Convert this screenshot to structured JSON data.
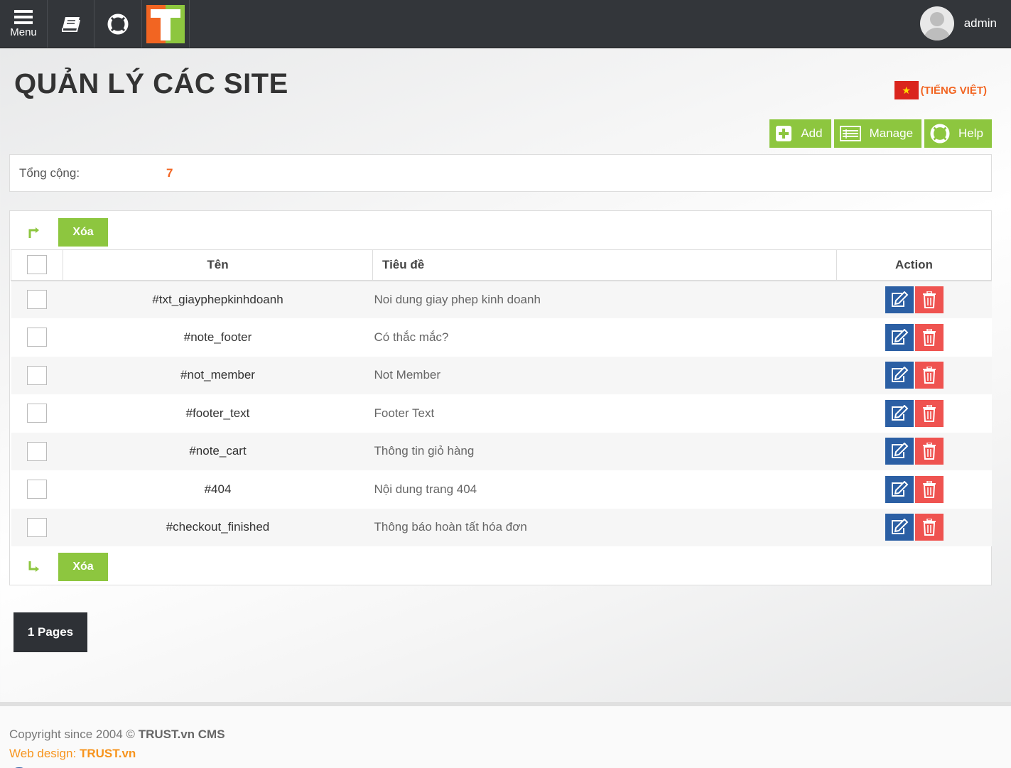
{
  "topbar": {
    "menu_label": "Menu",
    "icons": [
      "menu-icon",
      "book-icon",
      "lifebuoy-icon",
      "logo-icon"
    ],
    "username": "admin"
  },
  "header": {
    "title": "QUẢN LÝ CÁC SITE",
    "language": "(TIẾNG VIỆT)"
  },
  "actions": {
    "add": "Add",
    "manage": "Manage",
    "help": "Help"
  },
  "summary": {
    "total_label": "Tổng cộng:",
    "total_value": "7"
  },
  "bulk": {
    "delete_label": "Xóa"
  },
  "table": {
    "columns": {
      "name": "Tên",
      "title": "Tiêu đề",
      "action": "Action"
    },
    "rows": [
      {
        "name": "#txt_giayphepkinhdoanh",
        "title": "Noi dung giay phep kinh doanh"
      },
      {
        "name": "#note_footer",
        "title": "Có thắc mắc?"
      },
      {
        "name": "#not_member",
        "title": "Not Member"
      },
      {
        "name": "#footer_text",
        "title": "Footer Text"
      },
      {
        "name": "#note_cart",
        "title": "Thông tin giỏ hàng"
      },
      {
        "name": "#404",
        "title": "Nội dung trang 404"
      },
      {
        "name": "#checkout_finished",
        "title": "Thông báo hoàn tất hóa đơn"
      }
    ]
  },
  "pagination": {
    "label": "1 Pages"
  },
  "footer": {
    "copyright_prefix": "Copyright since 2004 ©",
    "copyright_brand": "TRUST.vn CMS",
    "webdesign_prefix": "Web design:",
    "webdesign_brand": "TRUST.vn"
  },
  "colors": {
    "topbar": "#33363a",
    "accent_green": "#8dc63f",
    "accent_orange": "#f26522",
    "edit_blue": "#2b5fa4",
    "delete_red": "#ef5350"
  }
}
